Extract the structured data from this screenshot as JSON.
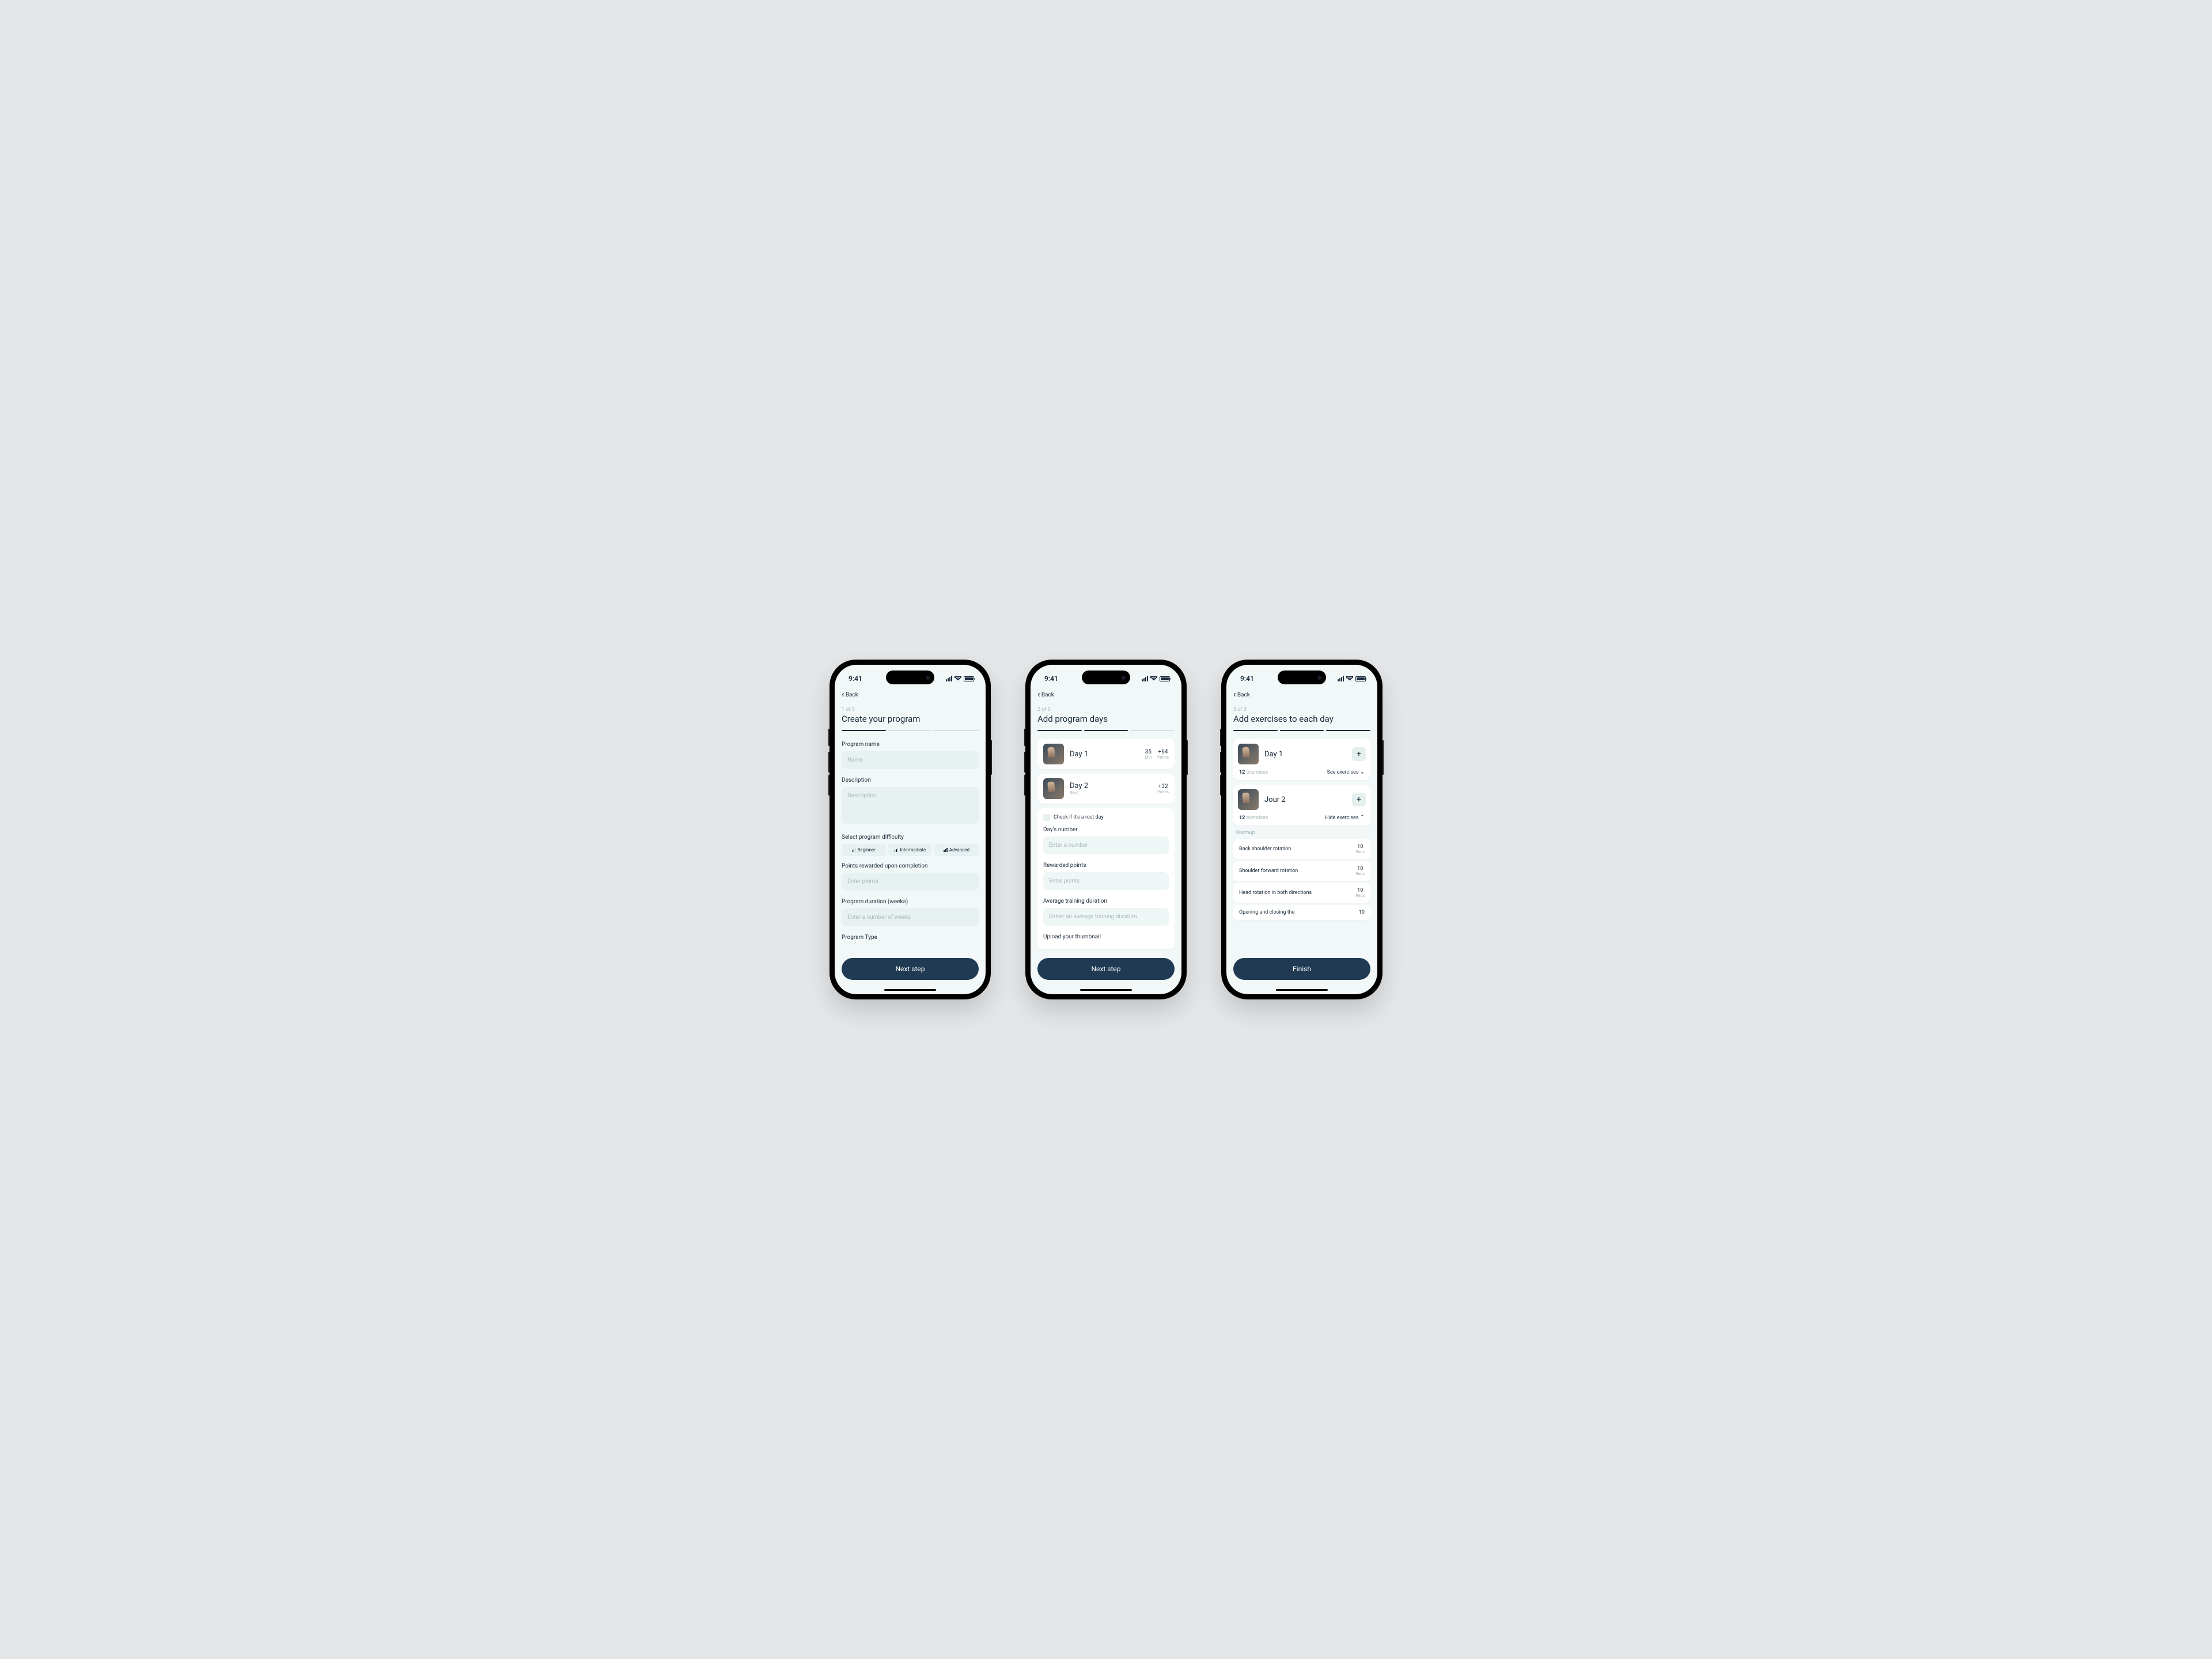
{
  "status": {
    "time": "9:41"
  },
  "nav": {
    "back": "Back"
  },
  "screen1": {
    "step": "1 of 3",
    "title": "Create your program",
    "progress_active": 1,
    "labels": {
      "program_name": "Program name",
      "description": "Description",
      "difficulty": "Select program difficulty",
      "points": "Points rewarded upon completion",
      "duration": "Program duration (weeks)",
      "type": "Program Type"
    },
    "placeholders": {
      "name": "Name",
      "description": "Description",
      "points": "Enter points",
      "duration": "Enter a number of weeks"
    },
    "difficulties": [
      "Beginner",
      "Intermediate",
      "Advanced"
    ],
    "cta": "Next step"
  },
  "screen2": {
    "step": "2 of 3",
    "title": "Add program days",
    "progress_active": 2,
    "days": [
      {
        "title": "Day 1",
        "sub": "",
        "min": "35",
        "min_lbl": "Min",
        "points": "+64",
        "points_lbl": "Points"
      },
      {
        "title": "Day 2",
        "sub": "Rest",
        "points": "+32",
        "points_lbl": "Points"
      }
    ],
    "form": {
      "check_label": "Check if it's a rest day.",
      "labels": {
        "day_number": "Day's number",
        "rewarded": "Rewarded points",
        "avg_duration": "Average training duration",
        "upload": "Upload your thumbnail"
      },
      "placeholders": {
        "day_number": "Enter a number",
        "rewarded": "Enter points",
        "avg_duration": "Entrer an average training duration"
      }
    },
    "cta": "Next step"
  },
  "screen3": {
    "step": "3 of 3",
    "title": "Add exercises to each day",
    "progress_active": 3,
    "day1": {
      "title": "Day 1",
      "count": "12",
      "count_lbl": "exercises",
      "see": "See exercises"
    },
    "day2": {
      "title": "Jour 2",
      "count": "12",
      "count_lbl": "exercises",
      "hide": "Hide exercises",
      "section": "Warmup",
      "exercises": [
        {
          "name": "Back shoulder rotation",
          "reps": "10",
          "reps_lbl": "Reps"
        },
        {
          "name": "Shoulder forward rotation",
          "reps": "10",
          "reps_lbl": "Reps"
        },
        {
          "name": "Head rotation in both directions",
          "reps": "10",
          "reps_lbl": "Reps"
        },
        {
          "name": "Opening and closing the",
          "reps": "10",
          "reps_lbl": ""
        }
      ]
    },
    "cta": "Finish"
  }
}
